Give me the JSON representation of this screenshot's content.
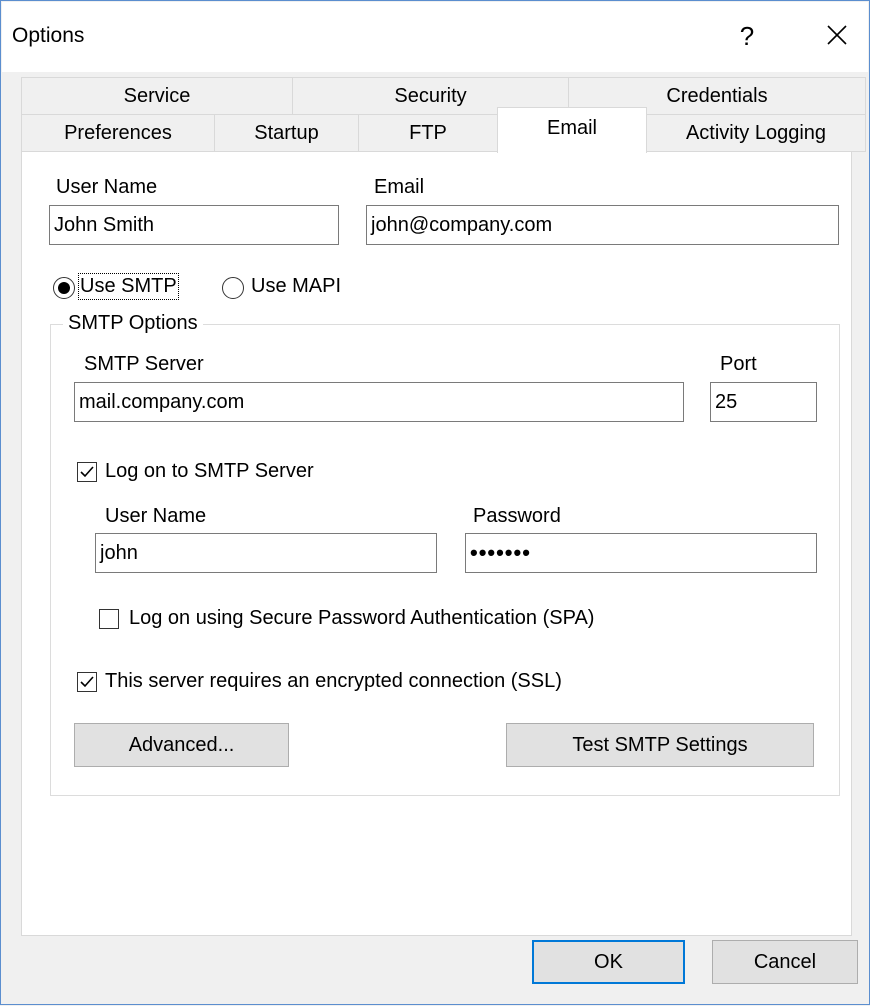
{
  "window": {
    "title": "Options",
    "help_glyph": "?",
    "close_icon": "close-icon"
  },
  "tabs": {
    "row1": [
      "Service",
      "Security",
      "Credentials"
    ],
    "row2": [
      "Preferences",
      "Startup",
      "FTP",
      "Email",
      "Activity Logging"
    ],
    "active": "Email"
  },
  "email_tab": {
    "user_name_label": "User Name",
    "user_name_value": "John Smith",
    "email_label": "Email",
    "email_value": "john@company.com",
    "use_smtp_label": "Use SMTP",
    "use_smtp_selected": true,
    "use_mapi_label": "Use MAPI",
    "smtp_options": {
      "legend": "SMTP Options",
      "server_label": "SMTP Server",
      "server_value": "mail.company.com",
      "port_label": "Port",
      "port_value": "25",
      "logon_label": "Log on to SMTP Server",
      "logon_checked": true,
      "logon_user_label": "User Name",
      "logon_user_value": "john",
      "password_label": "Password",
      "password_value": "•••••••",
      "spa_label": "Log on using Secure Password Authentication (SPA)",
      "spa_checked": false,
      "ssl_label": "This server requires an encrypted connection (SSL)",
      "ssl_checked": true,
      "advanced_button": "Advanced...",
      "test_button": "Test SMTP Settings"
    }
  },
  "footer": {
    "ok_button": "OK",
    "cancel_button": "Cancel"
  },
  "colors": {
    "accent": "#0078d7",
    "window_border": "#5b8ecf",
    "background": "#f0f0f0"
  }
}
